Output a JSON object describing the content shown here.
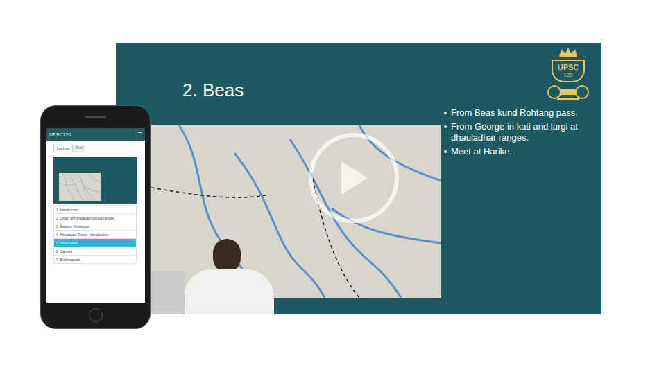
{
  "player": {
    "slide_title": "2. Beas",
    "bullets": [
      "From Beas kund Rohtang pass.",
      "From George in kati and largi at dhauladhar ranges.",
      "Meet at Harike."
    ],
    "logo": {
      "top": "UPSC",
      "bottom": "120"
    }
  },
  "phone": {
    "app_title": "UPSC120",
    "menu_icon": "☰",
    "tabs": [
      {
        "label": "Lecture",
        "selected": true
      },
      {
        "label": "Test",
        "selected": false
      }
    ],
    "lessons": [
      {
        "label": "1. Introduction",
        "selected": false
      },
      {
        "label": "2. Origin of Himalayas/various ranges",
        "selected": false
      },
      {
        "label": "3. Eastern Himalayas",
        "selected": false
      },
      {
        "label": "4. Himalayan Rivers : Introduction",
        "selected": false
      },
      {
        "label": "5. Indus River",
        "selected": true
      },
      {
        "label": "6. Ganges",
        "selected": false
      },
      {
        "label": "7. Brahmaputra",
        "selected": false
      }
    ]
  }
}
